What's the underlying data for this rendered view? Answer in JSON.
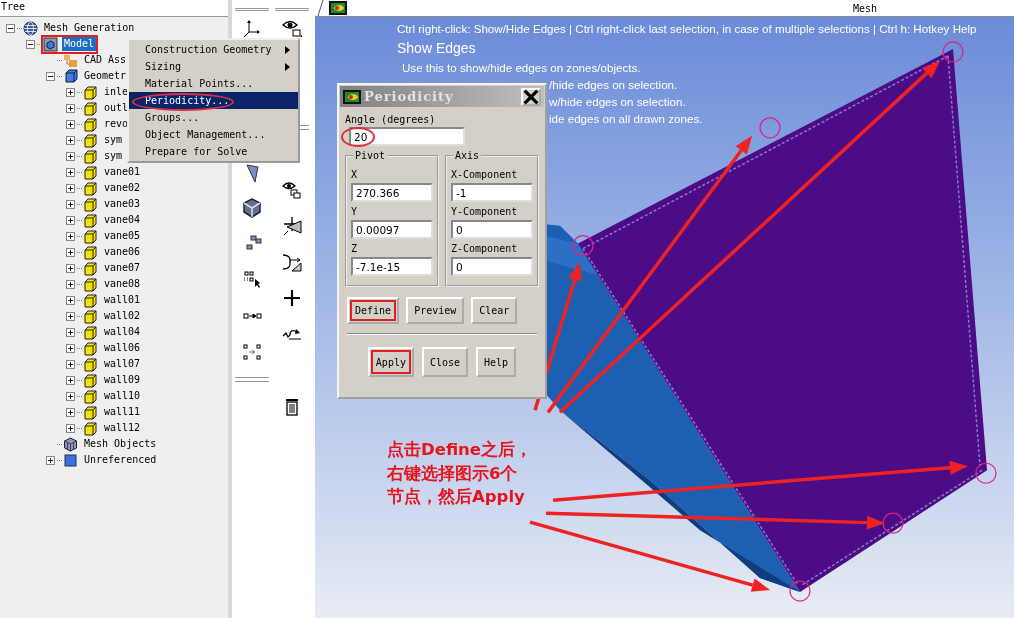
{
  "tree": {
    "title": "Tree",
    "items": [
      {
        "label": "Mesh Generation",
        "kind": "globe",
        "expanded": true,
        "selected": false,
        "highlighted": false,
        "children": [
          {
            "label": "Model",
            "kind": "model",
            "expanded": true,
            "selected": true,
            "highlighted": true,
            "children": [
              {
                "label": "CAD Ass",
                "kind": "cad",
                "selected": false,
                "highlighted": false
              },
              {
                "label": "Geometr",
                "kind": "geometry",
                "expanded": true,
                "selected": false,
                "highlighted": false,
                "children": [
                  {
                    "label": "inle",
                    "kind": "part",
                    "expanded": false,
                    "selected": false,
                    "highlighted": false
                  },
                  {
                    "label": "outl",
                    "kind": "part",
                    "expanded": false,
                    "selected": false,
                    "highlighted": false
                  },
                  {
                    "label": "revo",
                    "kind": "part",
                    "expanded": false,
                    "selected": false,
                    "highlighted": false
                  },
                  {
                    "label": "sym",
                    "kind": "part",
                    "expanded": false,
                    "selected": false,
                    "highlighted": false
                  },
                  {
                    "label": "sym",
                    "kind": "part",
                    "expanded": false,
                    "selected": false,
                    "highlighted": false
                  },
                  {
                    "label": "vane01",
                    "kind": "part",
                    "expanded": false,
                    "selected": false,
                    "highlighted": false
                  },
                  {
                    "label": "vane02",
                    "kind": "part",
                    "expanded": false,
                    "selected": false,
                    "highlighted": false
                  },
                  {
                    "label": "vane03",
                    "kind": "part",
                    "expanded": false,
                    "selected": false,
                    "highlighted": false
                  },
                  {
                    "label": "vane04",
                    "kind": "part",
                    "expanded": false,
                    "selected": false,
                    "highlighted": false
                  },
                  {
                    "label": "vane05",
                    "kind": "part",
                    "expanded": false,
                    "selected": false,
                    "highlighted": false
                  },
                  {
                    "label": "vane06",
                    "kind": "part",
                    "expanded": false,
                    "selected": false,
                    "highlighted": false
                  },
                  {
                    "label": "vane07",
                    "kind": "part",
                    "expanded": false,
                    "selected": false,
                    "highlighted": false
                  },
                  {
                    "label": "vane08",
                    "kind": "part",
                    "expanded": false,
                    "selected": false,
                    "highlighted": false
                  },
                  {
                    "label": "wall01",
                    "kind": "part",
                    "expanded": false,
                    "selected": false,
                    "highlighted": false
                  },
                  {
                    "label": "wall02",
                    "kind": "part",
                    "expanded": false,
                    "selected": false,
                    "highlighted": false
                  },
                  {
                    "label": "wall04",
                    "kind": "part",
                    "expanded": false,
                    "selected": false,
                    "highlighted": false
                  },
                  {
                    "label": "wall06",
                    "kind": "part",
                    "expanded": false,
                    "selected": false,
                    "highlighted": false
                  },
                  {
                    "label": "wall07",
                    "kind": "part",
                    "expanded": false,
                    "selected": false,
                    "highlighted": false
                  },
                  {
                    "label": "wall09",
                    "kind": "part",
                    "expanded": false,
                    "selected": false,
                    "highlighted": false
                  },
                  {
                    "label": "wall10",
                    "kind": "part",
                    "expanded": false,
                    "selected": false,
                    "highlighted": false
                  },
                  {
                    "label": "wall11",
                    "kind": "part",
                    "expanded": false,
                    "selected": false,
                    "highlighted": false
                  },
                  {
                    "label": "wall12",
                    "kind": "part",
                    "expanded": false,
                    "selected": false,
                    "highlighted": false
                  }
                ]
              },
              {
                "label": "Mesh Objects",
                "kind": "mesh",
                "selected": false,
                "highlighted": false
              },
              {
                "label": "Unreferenced",
                "kind": "unreferenced",
                "expanded": false,
                "selected": false,
                "highlighted": false
              }
            ]
          }
        ]
      }
    ]
  },
  "context_menu": {
    "items": [
      {
        "label": "Construction Geometry",
        "submenu": true,
        "selected": false,
        "circled": false
      },
      {
        "label": "Sizing",
        "submenu": true,
        "selected": false,
        "circled": false
      },
      {
        "label": "Material Points...",
        "submenu": false,
        "selected": false,
        "circled": false
      },
      {
        "label": "Periodicity...",
        "submenu": false,
        "selected": true,
        "circled": true
      },
      {
        "label": "Groups...",
        "submenu": false,
        "selected": false,
        "circled": false
      },
      {
        "label": "Object Management...",
        "submenu": false,
        "selected": false,
        "circled": false
      },
      {
        "label": "Prepare for Solve",
        "submenu": false,
        "selected": false,
        "circled": false
      }
    ]
  },
  "viewport": {
    "title": "Mesh",
    "hint": {
      "shortcuts": "Ctrl right-click: Show/Hide Edges | Ctrl right-click last selection, in case of multiple selections | Ctrl h: Hotkey Help",
      "title": "Show Edges",
      "lines": [
        "Use this to show/hide edges on zones/objects.",
        "/hide edges on selection.",
        "w/hide edges on selection.",
        "ide edges on all drawn zones."
      ]
    },
    "annotation": {
      "lines": [
        "点击Define之后，",
        "右键选择图示6个",
        "节点，然后Apply"
      ]
    }
  },
  "dialog": {
    "title": "Periodicity",
    "angle": {
      "label": "Angle (degrees)",
      "value": "20",
      "circled": true
    },
    "groups": [
      {
        "title": "Pivot",
        "fields": [
          {
            "label": "X",
            "value": "270.366"
          },
          {
            "label": "Y",
            "value": "0.00097"
          },
          {
            "label": "Z",
            "value": "-7.1e-15"
          }
        ]
      },
      {
        "title": "Axis",
        "fields": [
          {
            "label": "X-Component",
            "value": "-1"
          },
          {
            "label": "Y-Component",
            "value": "0"
          },
          {
            "label": "Z-Component",
            "value": "0"
          }
        ]
      }
    ],
    "action_buttons": [
      {
        "label": "Define",
        "highlighted": true
      },
      {
        "label": "Preview",
        "highlighted": false
      },
      {
        "label": "Clear",
        "highlighted": false
      }
    ],
    "bottom_buttons": [
      {
        "label": "Apply",
        "highlighted": true
      },
      {
        "label": "Close",
        "highlighted": false
      },
      {
        "label": "Help",
        "highlighted": false
      }
    ]
  }
}
